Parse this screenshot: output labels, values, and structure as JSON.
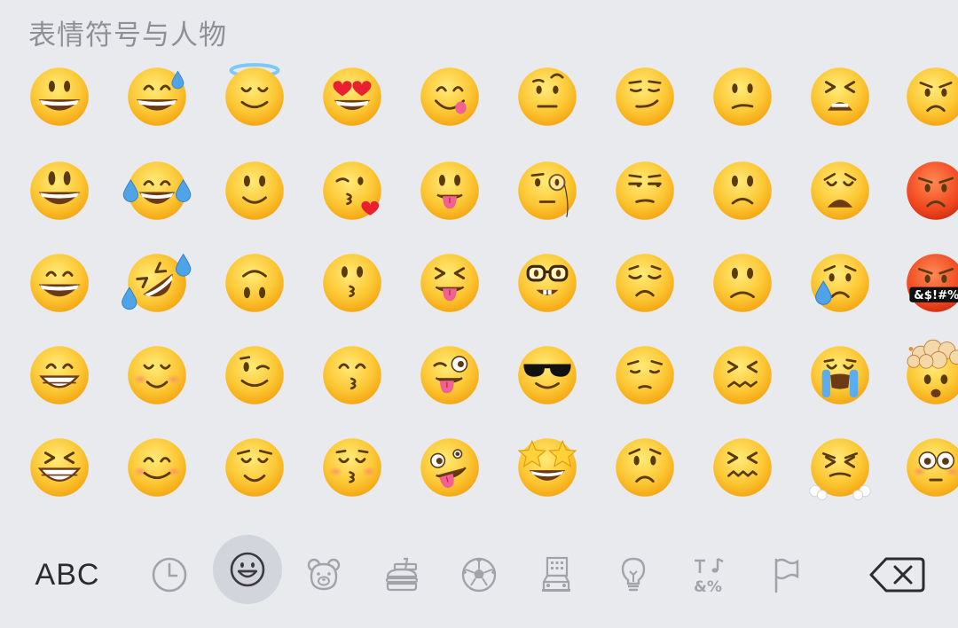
{
  "header": {
    "title": "表情符号与人物"
  },
  "emoji_grid": {
    "rows": [
      [
        "grinning-face",
        "grinning-face-with-sweat",
        "smiling-face-with-halo",
        "smiling-face-with-heart-eyes",
        "face-savoring-food",
        "face-with-raised-eyebrow",
        "smirking-face",
        "confused-face",
        "tired-face",
        "angry-face"
      ],
      [
        "grinning-face-big-eyes",
        "face-with-tears-of-joy",
        "slightly-smiling-face",
        "face-blowing-a-kiss",
        "face-with-tongue",
        "face-with-monocle",
        "unamused-face",
        "slightly-frowning-face",
        "weary-face",
        "pouting-face"
      ],
      [
        "grinning-face-smiling-eyes",
        "rolling-on-the-floor-laughing",
        "upside-down-face",
        "kissing-face",
        "squinting-face-with-tongue",
        "nerd-face",
        "disappointed-face",
        "frowning-face",
        "crying-face",
        "face-with-symbols-on-mouth"
      ],
      [
        "beaming-face-smiling-eyes",
        "smiling-face",
        "winking-face",
        "kissing-face-smiling-eyes",
        "winking-face-with-tongue",
        "smiling-face-with-sunglasses",
        "pensive-face",
        "confounded-face",
        "loudly-crying-face",
        "exploding-head"
      ],
      [
        "grinning-squinting-face",
        "smiling-face-with-smiling-eyes",
        "relieved-face",
        "kissing-face-closed-eyes",
        "zany-face",
        "star-struck",
        "worried-face",
        "persevering-face",
        "face-with-steam-from-nose",
        "flushed-face"
      ]
    ],
    "symbols_text": "&$!#%"
  },
  "toolbar": {
    "abc_label": "ABC",
    "categories": [
      {
        "name": "recent",
        "icon": "clock-icon"
      },
      {
        "name": "smileys-people",
        "icon": "smiley-icon",
        "selected": true
      },
      {
        "name": "animals-nature",
        "icon": "bear-icon"
      },
      {
        "name": "food-drink",
        "icon": "burger-icon"
      },
      {
        "name": "activity",
        "icon": "soccer-ball-icon"
      },
      {
        "name": "travel-places",
        "icon": "car-building-icon"
      },
      {
        "name": "objects",
        "icon": "lightbulb-icon"
      },
      {
        "name": "symbols",
        "icon": "symbols-icon"
      },
      {
        "name": "flags",
        "icon": "flag-icon"
      }
    ],
    "delete_icon": "backspace-icon"
  },
  "colors": {
    "background": "#e9eaee",
    "face_light": "#ffe36b",
    "face_dark": "#f3a10e",
    "feature": "#5a3a0e",
    "mouth": "#6d3a16",
    "tongue": "#f06292",
    "icon_gray": "#a2a3a8",
    "selected_bg": "#d2d5db"
  }
}
